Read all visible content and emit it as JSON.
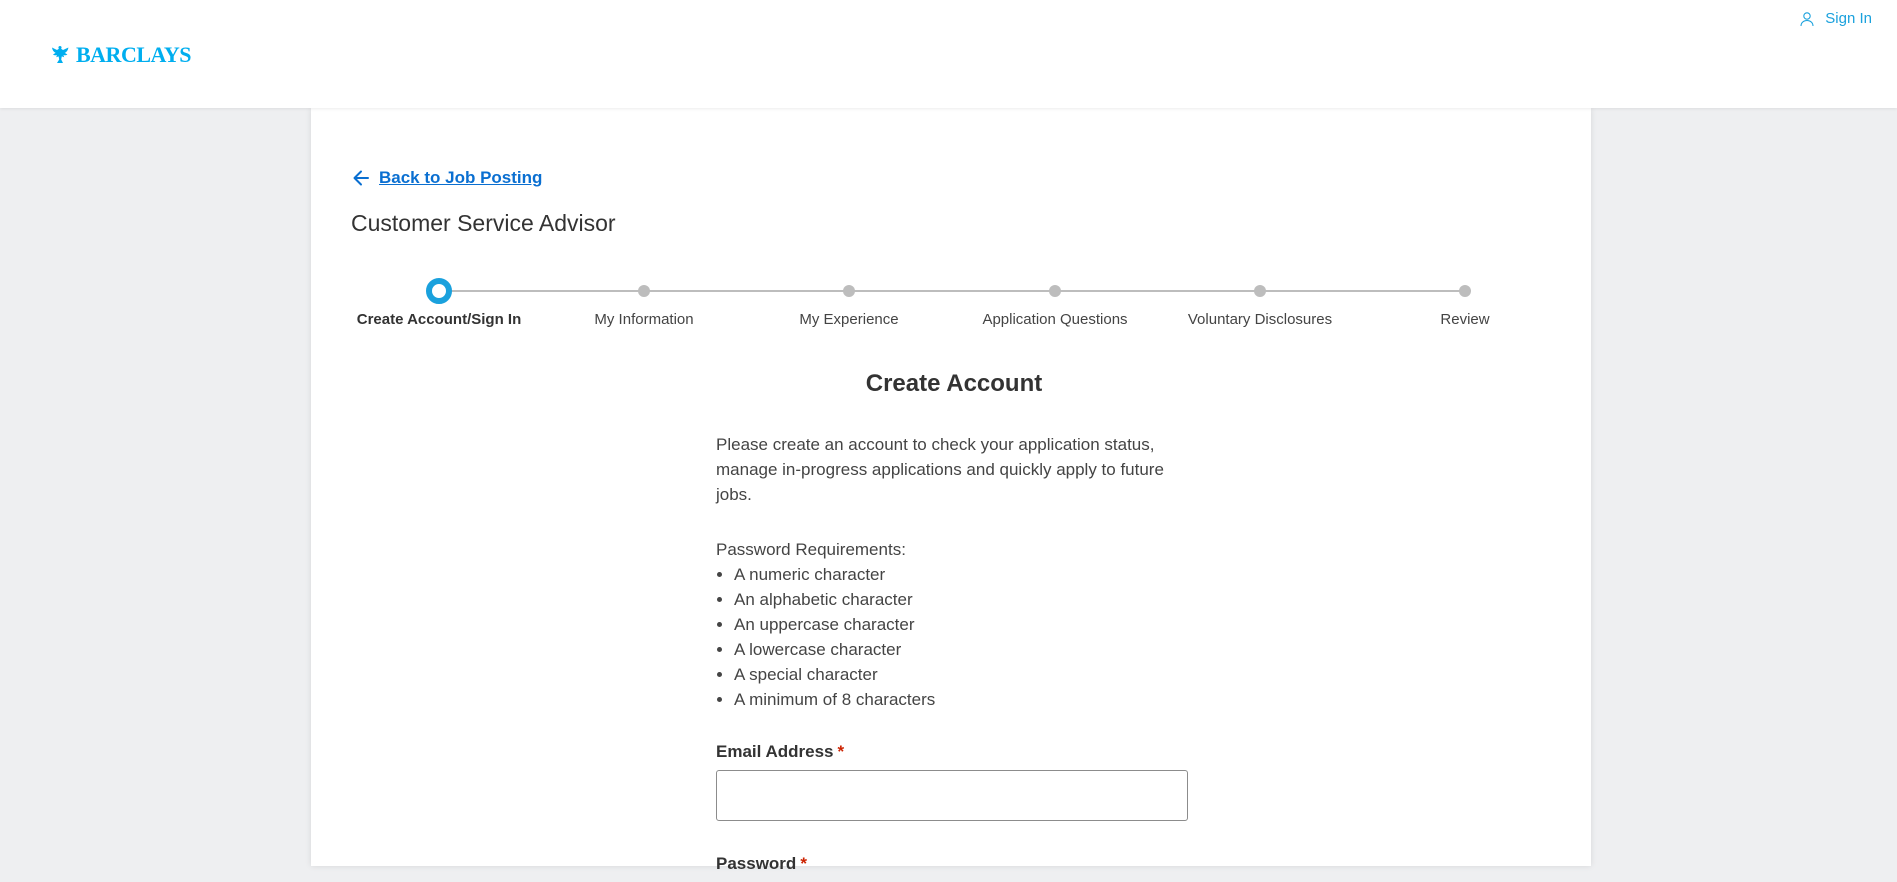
{
  "header": {
    "logo_text": "BARCLAYS",
    "signin_label": "Sign In"
  },
  "job": {
    "back_label": "Back to Job Posting",
    "title": "Customer Service Advisor"
  },
  "steps": [
    {
      "label": "Create Account/Sign In",
      "active": true
    },
    {
      "label": "My Information",
      "active": false
    },
    {
      "label": "My Experience",
      "active": false
    },
    {
      "label": "Application Questions",
      "active": false
    },
    {
      "label": "Voluntary Disclosures",
      "active": false
    },
    {
      "label": "Review",
      "active": false
    }
  ],
  "form": {
    "heading": "Create Account",
    "intro": "Please create an account to check your application status, manage in-progress applications and quickly apply to future jobs.",
    "requirements_title": "Password Requirements:",
    "requirements": [
      "A numeric character",
      "An alphabetic character",
      "An uppercase character",
      "A lowercase character",
      "A special character",
      "A minimum of 8 characters"
    ],
    "email_label": "Email Address",
    "email_value": "",
    "password_label": "Password",
    "required_mark": "*"
  },
  "colors": {
    "brand": "#00aeef",
    "link": "#0a6fd1",
    "step_active": "#1aa1dd",
    "step_inactive": "#bdbdbd",
    "required": "#cc2200"
  },
  "icons": {
    "logo": "eagle-icon",
    "signin": "user-icon",
    "back": "arrow-left-icon"
  }
}
